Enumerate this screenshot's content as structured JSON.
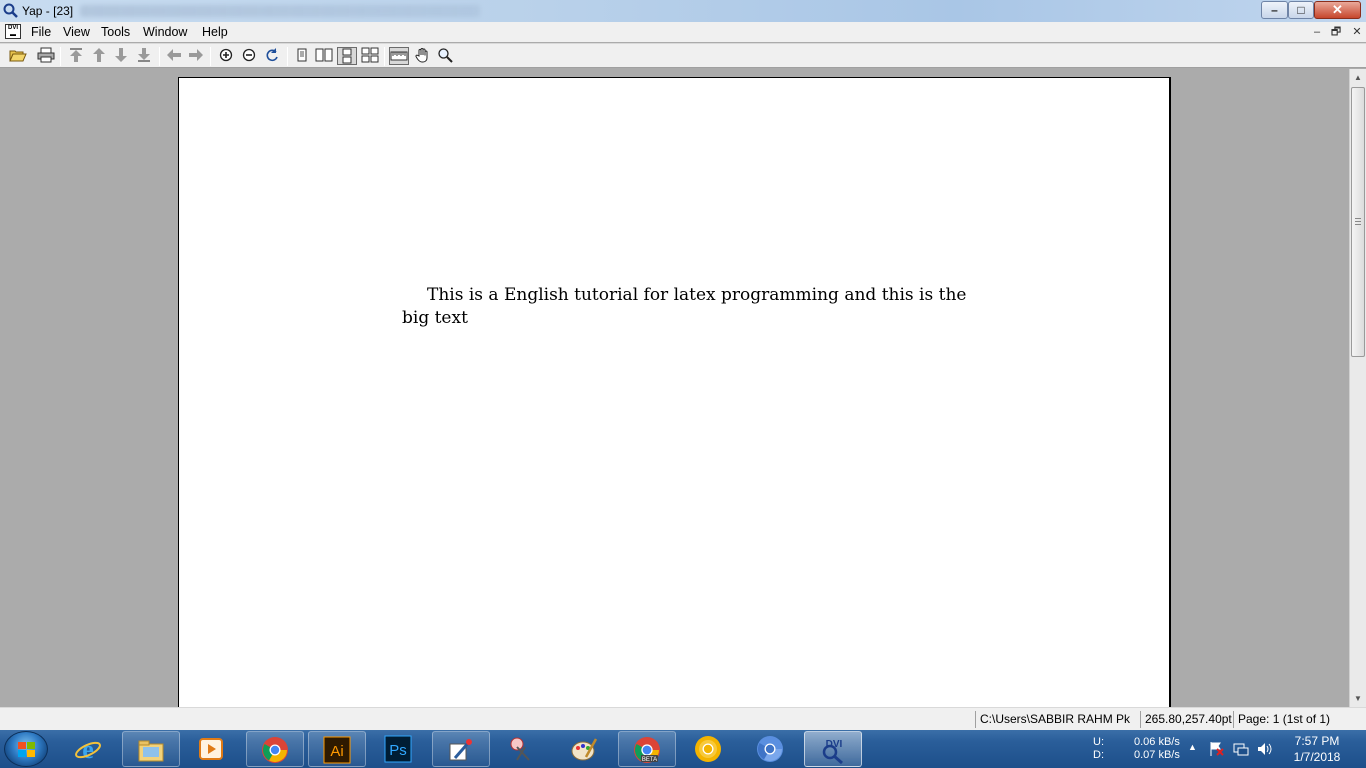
{
  "window": {
    "title": "Yap - [23]",
    "controls": {
      "minimize": "–",
      "maximize": "□",
      "close": "✕"
    }
  },
  "menu": {
    "items": [
      "File",
      "View",
      "Tools",
      "Window",
      "Help"
    ],
    "mdi_controls": [
      "–",
      "🗗",
      "✕"
    ]
  },
  "toolbar": {
    "buttons": [
      "open-icon",
      "print-icon",
      "first-page-icon",
      "previous-page-icon",
      "next-page-icon",
      "last-page-icon",
      "back-icon",
      "forward-icon",
      "zoom-in-icon",
      "zoom-out-icon",
      "refresh-icon",
      "single-page-icon",
      "double-page-icon",
      "continuous-single-icon",
      "continuous-double-icon",
      "ruler-icon",
      "hand-tool-icon",
      "magnifier-icon"
    ]
  },
  "document": {
    "line1": "This is a English tutorial for latex programming and this is the",
    "line2": "big text"
  },
  "status": {
    "path": "C:\\Users\\SABBIR RAHM  Pk",
    "coordinates": "265.80,257.40pt",
    "page": "Page: 1 (1st of 1)"
  },
  "taskbar": {
    "apps": [
      "internet-explorer",
      "file-explorer",
      "media-player",
      "chrome",
      "illustrator",
      "photoshop",
      "snipping-tool",
      "sticky-pens",
      "paint",
      "chrome-beta",
      "canary",
      "chromium",
      "yap-dvi"
    ],
    "illustrator_label": "Ai",
    "photoshop_label": "Ps",
    "chrome_beta_label": "BETA",
    "yap_label": "DVI",
    "network_up_label": "U:",
    "network_down_label": "D:",
    "network_up": "0.06 kB/s",
    "network_down": "0.07 kB/s",
    "time": "7:57 PM",
    "date": "1/7/2018"
  }
}
